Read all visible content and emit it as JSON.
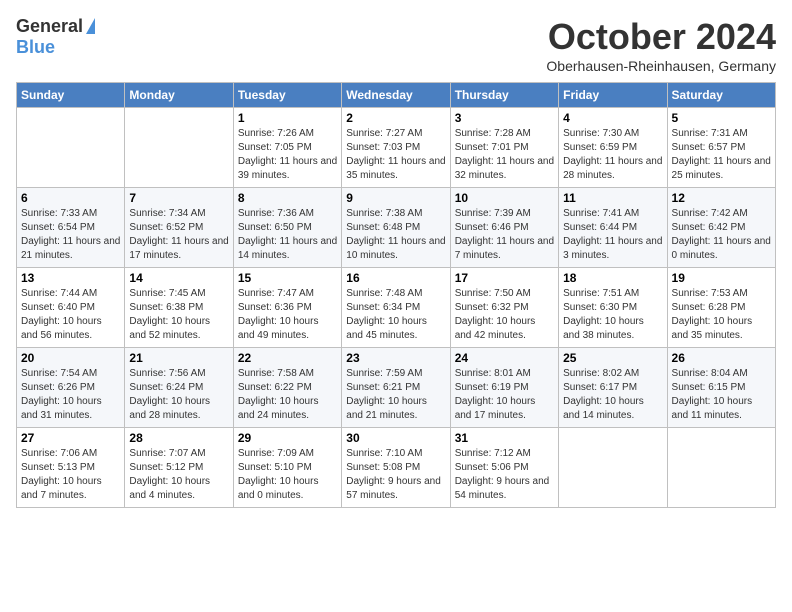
{
  "header": {
    "logo_general": "General",
    "logo_blue": "Blue",
    "month_title": "October 2024",
    "location": "Oberhausen-Rheinhausen, Germany"
  },
  "weekdays": [
    "Sunday",
    "Monday",
    "Tuesday",
    "Wednesday",
    "Thursday",
    "Friday",
    "Saturday"
  ],
  "weeks": [
    [
      {
        "day": "",
        "info": ""
      },
      {
        "day": "",
        "info": ""
      },
      {
        "day": "1",
        "info": "Sunrise: 7:26 AM\nSunset: 7:05 PM\nDaylight: 11 hours and 39 minutes."
      },
      {
        "day": "2",
        "info": "Sunrise: 7:27 AM\nSunset: 7:03 PM\nDaylight: 11 hours and 35 minutes."
      },
      {
        "day": "3",
        "info": "Sunrise: 7:28 AM\nSunset: 7:01 PM\nDaylight: 11 hours and 32 minutes."
      },
      {
        "day": "4",
        "info": "Sunrise: 7:30 AM\nSunset: 6:59 PM\nDaylight: 11 hours and 28 minutes."
      },
      {
        "day": "5",
        "info": "Sunrise: 7:31 AM\nSunset: 6:57 PM\nDaylight: 11 hours and 25 minutes."
      }
    ],
    [
      {
        "day": "6",
        "info": "Sunrise: 7:33 AM\nSunset: 6:54 PM\nDaylight: 11 hours and 21 minutes."
      },
      {
        "day": "7",
        "info": "Sunrise: 7:34 AM\nSunset: 6:52 PM\nDaylight: 11 hours and 17 minutes."
      },
      {
        "day": "8",
        "info": "Sunrise: 7:36 AM\nSunset: 6:50 PM\nDaylight: 11 hours and 14 minutes."
      },
      {
        "day": "9",
        "info": "Sunrise: 7:38 AM\nSunset: 6:48 PM\nDaylight: 11 hours and 10 minutes."
      },
      {
        "day": "10",
        "info": "Sunrise: 7:39 AM\nSunset: 6:46 PM\nDaylight: 11 hours and 7 minutes."
      },
      {
        "day": "11",
        "info": "Sunrise: 7:41 AM\nSunset: 6:44 PM\nDaylight: 11 hours and 3 minutes."
      },
      {
        "day": "12",
        "info": "Sunrise: 7:42 AM\nSunset: 6:42 PM\nDaylight: 11 hours and 0 minutes."
      }
    ],
    [
      {
        "day": "13",
        "info": "Sunrise: 7:44 AM\nSunset: 6:40 PM\nDaylight: 10 hours and 56 minutes."
      },
      {
        "day": "14",
        "info": "Sunrise: 7:45 AM\nSunset: 6:38 PM\nDaylight: 10 hours and 52 minutes."
      },
      {
        "day": "15",
        "info": "Sunrise: 7:47 AM\nSunset: 6:36 PM\nDaylight: 10 hours and 49 minutes."
      },
      {
        "day": "16",
        "info": "Sunrise: 7:48 AM\nSunset: 6:34 PM\nDaylight: 10 hours and 45 minutes."
      },
      {
        "day": "17",
        "info": "Sunrise: 7:50 AM\nSunset: 6:32 PM\nDaylight: 10 hours and 42 minutes."
      },
      {
        "day": "18",
        "info": "Sunrise: 7:51 AM\nSunset: 6:30 PM\nDaylight: 10 hours and 38 minutes."
      },
      {
        "day": "19",
        "info": "Sunrise: 7:53 AM\nSunset: 6:28 PM\nDaylight: 10 hours and 35 minutes."
      }
    ],
    [
      {
        "day": "20",
        "info": "Sunrise: 7:54 AM\nSunset: 6:26 PM\nDaylight: 10 hours and 31 minutes."
      },
      {
        "day": "21",
        "info": "Sunrise: 7:56 AM\nSunset: 6:24 PM\nDaylight: 10 hours and 28 minutes."
      },
      {
        "day": "22",
        "info": "Sunrise: 7:58 AM\nSunset: 6:22 PM\nDaylight: 10 hours and 24 minutes."
      },
      {
        "day": "23",
        "info": "Sunrise: 7:59 AM\nSunset: 6:21 PM\nDaylight: 10 hours and 21 minutes."
      },
      {
        "day": "24",
        "info": "Sunrise: 8:01 AM\nSunset: 6:19 PM\nDaylight: 10 hours and 17 minutes."
      },
      {
        "day": "25",
        "info": "Sunrise: 8:02 AM\nSunset: 6:17 PM\nDaylight: 10 hours and 14 minutes."
      },
      {
        "day": "26",
        "info": "Sunrise: 8:04 AM\nSunset: 6:15 PM\nDaylight: 10 hours and 11 minutes."
      }
    ],
    [
      {
        "day": "27",
        "info": "Sunrise: 7:06 AM\nSunset: 5:13 PM\nDaylight: 10 hours and 7 minutes."
      },
      {
        "day": "28",
        "info": "Sunrise: 7:07 AM\nSunset: 5:12 PM\nDaylight: 10 hours and 4 minutes."
      },
      {
        "day": "29",
        "info": "Sunrise: 7:09 AM\nSunset: 5:10 PM\nDaylight: 10 hours and 0 minutes."
      },
      {
        "day": "30",
        "info": "Sunrise: 7:10 AM\nSunset: 5:08 PM\nDaylight: 9 hours and 57 minutes."
      },
      {
        "day": "31",
        "info": "Sunrise: 7:12 AM\nSunset: 5:06 PM\nDaylight: 9 hours and 54 minutes."
      },
      {
        "day": "",
        "info": ""
      },
      {
        "day": "",
        "info": ""
      }
    ]
  ]
}
